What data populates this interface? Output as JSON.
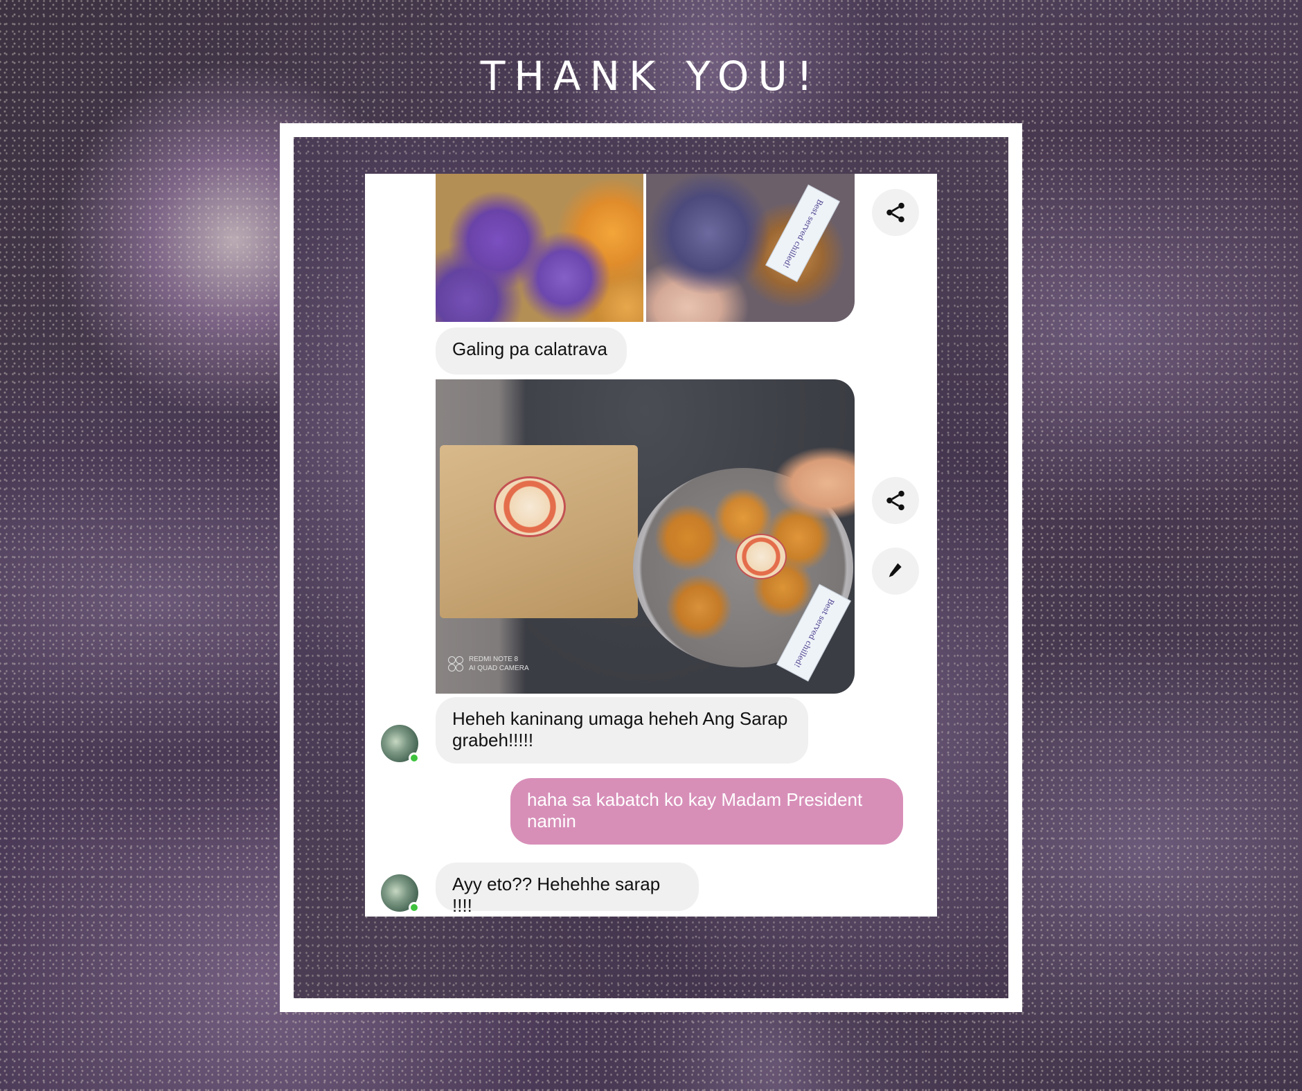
{
  "heading": "THANK YOU!",
  "conversation": {
    "messages": [
      {
        "sender": "them",
        "text": "Galing pa calatrava"
      },
      {
        "sender": "them",
        "text": "Heheh kaninang umaga heheh Ang Sarap grabeh!!!!!"
      },
      {
        "sender": "me",
        "text": "haha sa kabatch ko kay Madam President namin"
      },
      {
        "sender": "them",
        "text": "Ayy eto?? Hehehhe sarap !!!!"
      }
    ],
    "photo_note": "Best served chilled!",
    "camera_watermark": [
      "REDMI NOTE 8",
      "AI QUAD CAMERA"
    ]
  },
  "icons": {
    "share": "share-icon",
    "edit": "pencil-icon"
  },
  "colors": {
    "outgoing_bubble": "#d78fb8",
    "incoming_bubble": "#f0f0f0",
    "online_dot": "#3ec23e"
  }
}
